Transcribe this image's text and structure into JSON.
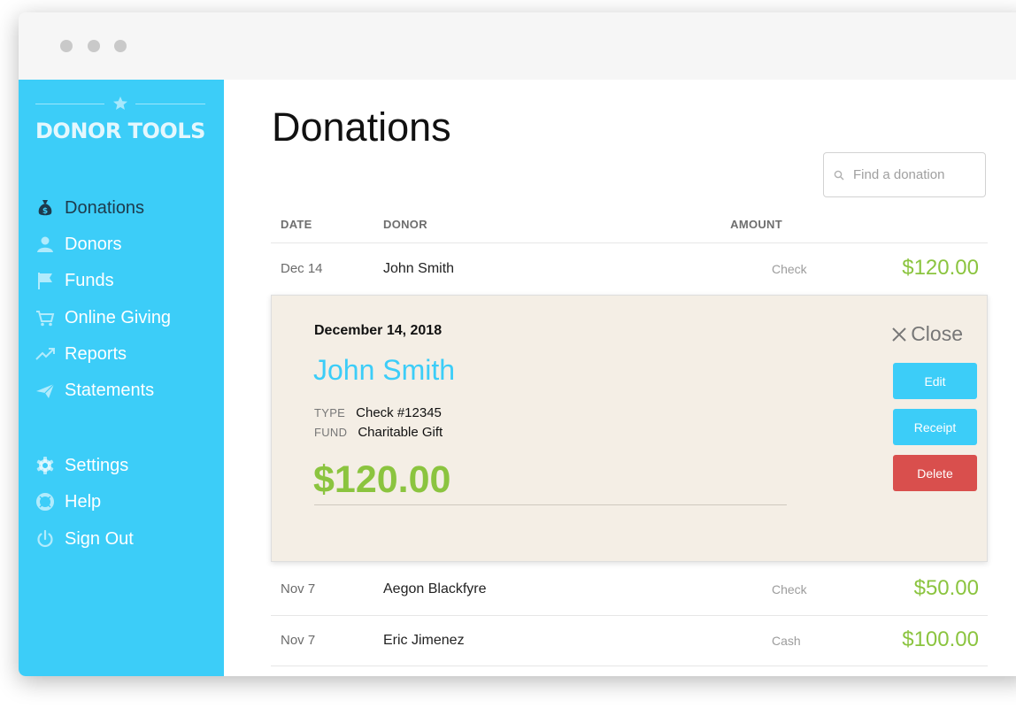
{
  "brand": {
    "name": "DONOR TOOLS"
  },
  "nav": {
    "main": [
      {
        "label": "Donations",
        "icon": "money-bag-icon",
        "active": true
      },
      {
        "label": "Donors",
        "icon": "person-icon"
      },
      {
        "label": "Funds",
        "icon": "flag-icon"
      },
      {
        "label": "Online Giving",
        "icon": "cart-icon"
      },
      {
        "label": "Reports",
        "icon": "trend-icon"
      },
      {
        "label": "Statements",
        "icon": "paper-plane-icon"
      }
    ],
    "secondary": [
      {
        "label": "Settings",
        "icon": "gear-icon"
      },
      {
        "label": "Help",
        "icon": "lifebuoy-icon"
      },
      {
        "label": "Sign Out",
        "icon": "power-icon"
      }
    ]
  },
  "page": {
    "title": "Donations"
  },
  "search": {
    "placeholder": "Find a donation",
    "value": ""
  },
  "table": {
    "headers": {
      "date": "DATE",
      "donor": "DONOR",
      "amount": "AMOUNT"
    },
    "rows": [
      {
        "date": "Dec 14",
        "donor": "John Smith",
        "type": "Check",
        "amount": "$120.00"
      },
      {
        "date": "Nov 7",
        "donor": "Aegon Blackfyre",
        "type": "Check",
        "amount": "$50.00"
      },
      {
        "date": "Nov 7",
        "donor": "Eric Jimenez",
        "type": "Cash",
        "amount": "$100.00"
      }
    ]
  },
  "detail": {
    "date": "December 14, 2018",
    "donor": "John Smith",
    "type_label": "TYPE",
    "type_value": "Check #12345",
    "fund_label": "FUND",
    "fund_value": "Charitable Gift",
    "amount": "$120.00",
    "close_label": "Close",
    "buttons": {
      "edit": "Edit",
      "receipt": "Receipt",
      "delete": "Delete"
    }
  },
  "colors": {
    "sidebar": "#3ccdf8",
    "accent_blue": "#3ccdf8",
    "amount_green": "#8bc43f",
    "delete_red": "#d94f4d",
    "active_nav": "#1d3a4c",
    "detail_bg": "#f4eee5"
  }
}
